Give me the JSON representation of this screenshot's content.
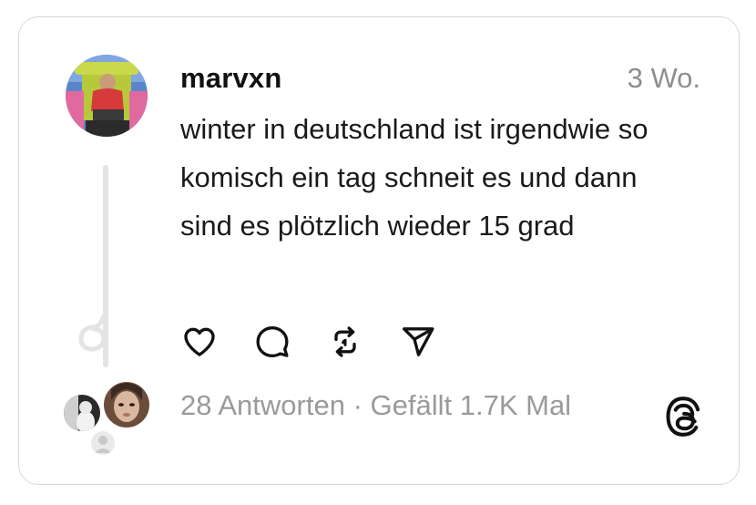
{
  "post": {
    "username": "marvxn",
    "timestamp": "3 Wo.",
    "text": "winter in deutschland ist irgendwie so komisch ein tag schneit es und dann sind es plötzlich wieder 15 grad"
  },
  "actions": {
    "like_icon": "heart-icon",
    "reply_icon": "comment-bubble-icon",
    "repost_icon": "repost-arrows-icon",
    "share_icon": "send-paper-plane-icon"
  },
  "stats": {
    "replies": "28 Antworten",
    "separator": " · ",
    "likes": "Gefällt 1.7K Mal"
  },
  "brand": {
    "logo_icon": "threads-logo-icon",
    "text_color": "#111111",
    "muted_color": "#8e8e8e",
    "border_color": "#d9d9d9"
  }
}
